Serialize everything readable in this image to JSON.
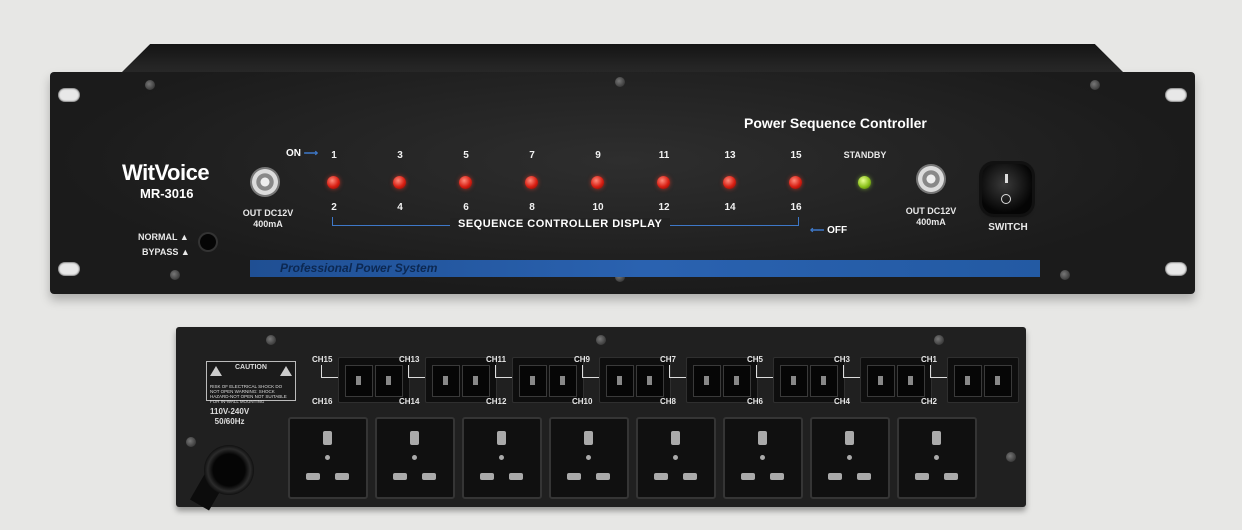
{
  "front": {
    "brand": "WitVoice",
    "model": "MR-3016",
    "product_title": "Power Sequence Controller",
    "out_left": "OUT DC12V",
    "out_left_current": "400mA",
    "out_right": "OUT DC12V",
    "out_right_current": "400mA",
    "on_label": "ON",
    "off_label": "OFF",
    "standby_label": "STANDBY",
    "switch_label": "SWITCH",
    "normal_label": "NORMAL",
    "bypass_label": "BYPASS",
    "display_label": "SEQUENCE CONTROLLER DISPLAY",
    "stripe_label": "Professional Power System",
    "top_channels": [
      "1",
      "3",
      "5",
      "7",
      "9",
      "11",
      "13",
      "15"
    ],
    "bottom_channels": [
      "2",
      "4",
      "6",
      "8",
      "10",
      "12",
      "14",
      "16"
    ],
    "led_color": "#d81e12",
    "standby_led_color": "#8cc21c",
    "stripe_color": "#2a62b0"
  },
  "rear": {
    "caution_title": "CAUTION",
    "caution_text": "RISK OF ELECTRICAL SHOCK DO NOT OPEN WARNING: SHOCK HAZARD-NOT OPEN NOT SUITABLE FOR IN-WALL MOUNTING",
    "voltage": "110V-240V",
    "frequency": "50/60Hz",
    "top_channels": [
      "CH15",
      "CH13",
      "CH11",
      "CH9",
      "CH7",
      "CH5",
      "CH3",
      "CH1"
    ],
    "bottom_channels": [
      "CH16",
      "CH14",
      "CH12",
      "CH10",
      "CH8",
      "CH6",
      "CH4",
      "CH2"
    ]
  }
}
